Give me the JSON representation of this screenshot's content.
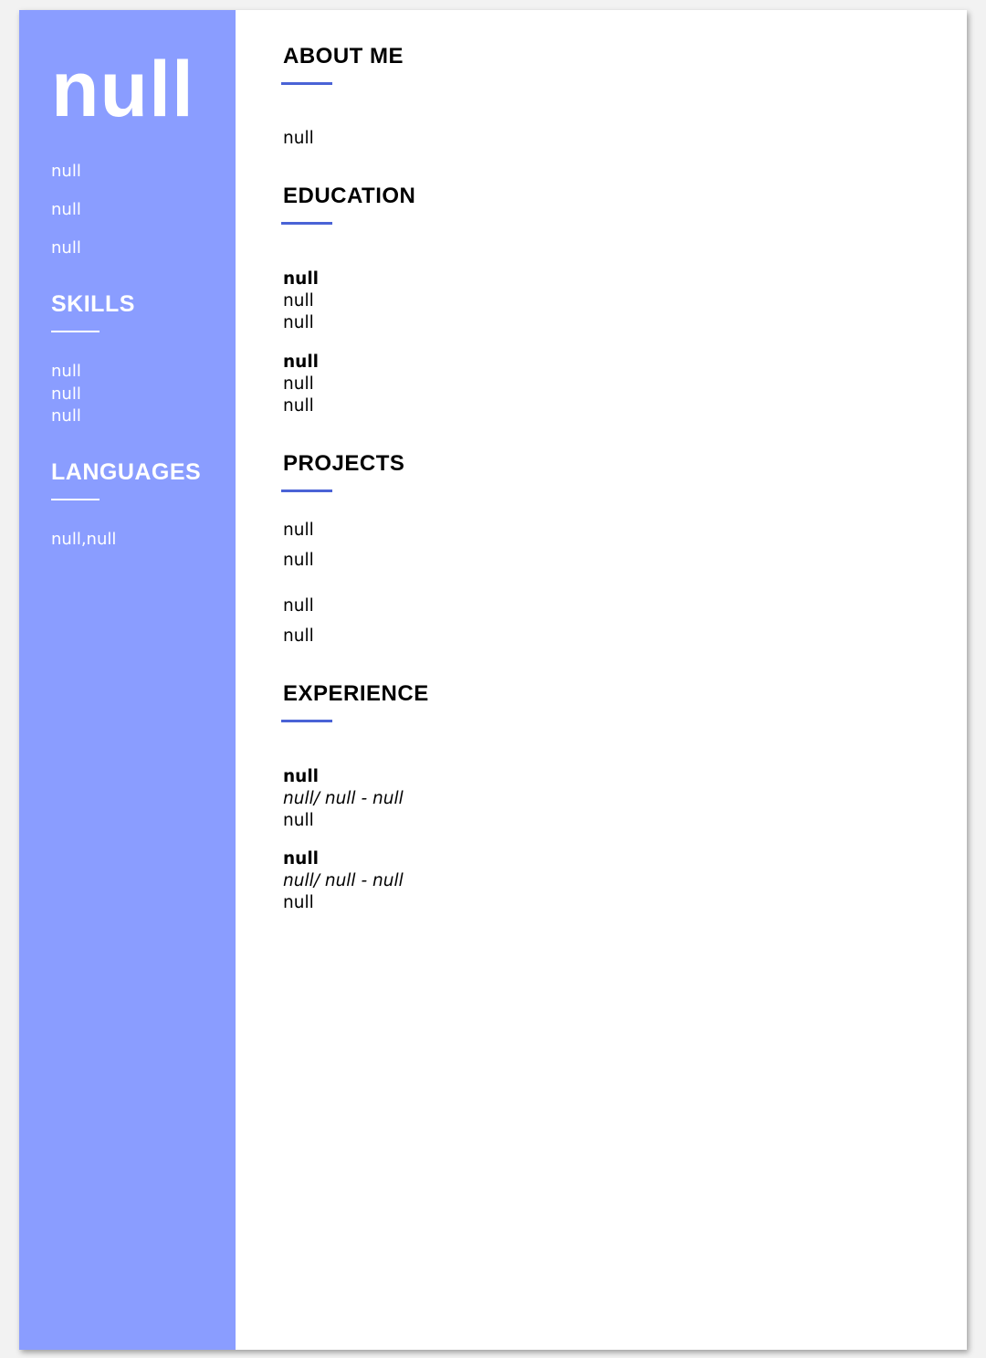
{
  "sidebar": {
    "name": "null",
    "contacts": [
      "null",
      "null",
      "null"
    ],
    "skills_heading": "SKILLS",
    "skills": [
      "null",
      "null",
      "null"
    ],
    "languages_heading": "LANGUAGES",
    "languages": "null,null"
  },
  "main": {
    "about": {
      "heading": "ABOUT ME",
      "text": "null"
    },
    "education": {
      "heading": "EDUCATION",
      "entries": [
        {
          "title": "null",
          "line1": "null",
          "line2": "null"
        },
        {
          "title": "null",
          "line1": "null",
          "line2": "null"
        }
      ]
    },
    "projects": {
      "heading": "PROJECTS",
      "entries": [
        {
          "name": "null",
          "description": "null"
        },
        {
          "name": "null",
          "description": "null"
        }
      ]
    },
    "experience": {
      "heading": "EXPERIENCE",
      "entries": [
        {
          "title": "null",
          "meta": "null/ null - null",
          "description": "null"
        },
        {
          "title": "null",
          "meta": "null/ null - null",
          "description": "null"
        }
      ]
    }
  },
  "colors": {
    "sidebar_bg": "#8a9dff",
    "accent": "#4a63d6",
    "text": "#000000"
  }
}
